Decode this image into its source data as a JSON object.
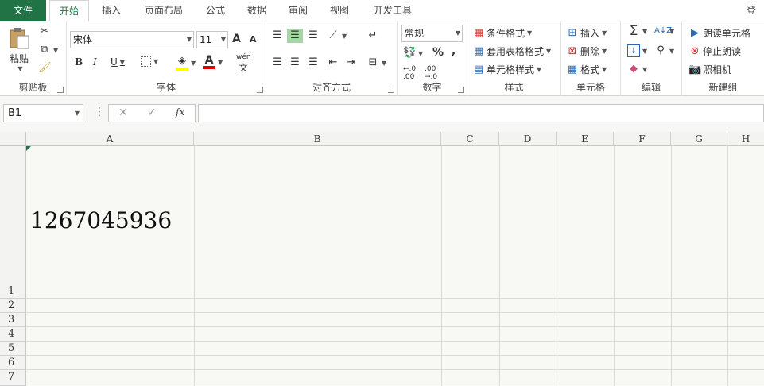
{
  "tabs": {
    "file": "文件",
    "home": "开始",
    "insert": "插入",
    "page_layout": "页面布局",
    "formulas": "公式",
    "data": "数据",
    "review": "审阅",
    "view": "视图",
    "developer": "开发工具",
    "login": "登录"
  },
  "clipboard": {
    "paste": "粘贴",
    "label": "剪贴板"
  },
  "font": {
    "name": "宋体",
    "size": "11",
    "label": "字体",
    "bold": "B",
    "italic": "I",
    "underline": "U",
    "grow": "A",
    "shrink": "A",
    "font_color": "A",
    "phonetic": "wén"
  },
  "alignment": {
    "label": "对齐方式"
  },
  "number": {
    "format": "常规",
    "label": "数字",
    "percent": "%",
    "comma": ","
  },
  "styles": {
    "conditional": "条件格式",
    "table_format": "套用表格格式",
    "cell_styles": "单元格样式",
    "label": "样式"
  },
  "cells": {
    "insert": "插入",
    "delete": "删除",
    "format": "格式",
    "label": "单元格"
  },
  "editing": {
    "label": "编辑"
  },
  "new_group": {
    "read_cells": "朗读单元格",
    "stop_reading": "停止朗读",
    "camera": "照相机",
    "label": "新建组"
  },
  "formula_bar": {
    "name_box": "B1",
    "fx": "fx",
    "cancel": "✕",
    "enter": "✓",
    "content": ""
  },
  "columns": [
    "A",
    "B",
    "C",
    "D",
    "E",
    "F",
    "G",
    "H"
  ],
  "rows": [
    "1",
    "2",
    "3",
    "4",
    "5",
    "6",
    "7"
  ],
  "cells_data": {
    "A1": "1267045936"
  },
  "colors": {
    "accent": "#217346",
    "highlight_yellow": "#ffff00",
    "font_red": "#e00000"
  }
}
